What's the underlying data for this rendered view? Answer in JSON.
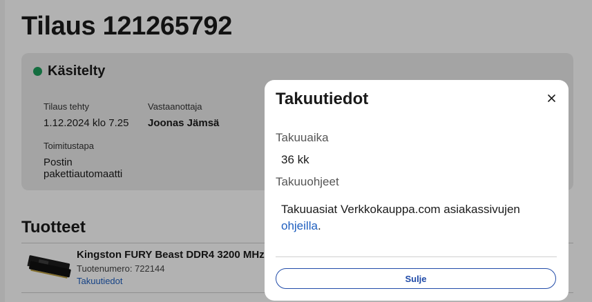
{
  "order": {
    "title": "Tilaus 121265792",
    "status": "Käsitelty",
    "status_color": "#1e9e5c",
    "order_date_label": "Tilaus tehty",
    "order_date_value": "1.12.2024 klo 7.25",
    "recipient_label": "Vastaanottaja",
    "recipient_value": "Joonas Jämsä",
    "delivery_label": "Toimitustapa",
    "delivery_value_line1": "Postin",
    "delivery_value_line2": "pakettiautomaatti"
  },
  "products": {
    "section_title": "Tuotteet",
    "items": [
      {
        "name": "Kingston FURY Beast DDR4 3200 MHz",
        "sku": "Tuotenumero: 722144",
        "warranty_link": "Takuutiedot",
        "image_icon": "ram-module-icon"
      }
    ]
  },
  "modal": {
    "title": "Takuutiedot",
    "close_icon": "close-icon",
    "warranty_period_label": "Takuuaika",
    "warranty_period_value": "36 kk",
    "warranty_instructions_label": "Takuuohjeet",
    "instructions_text": "Takuuasiat Verkkokauppa.com asiakassivujen",
    "instructions_link": "ohjeilla",
    "instructions_suffix": ".",
    "close_button_label": "Sulje",
    "accent_color": "#1f4aa8"
  }
}
